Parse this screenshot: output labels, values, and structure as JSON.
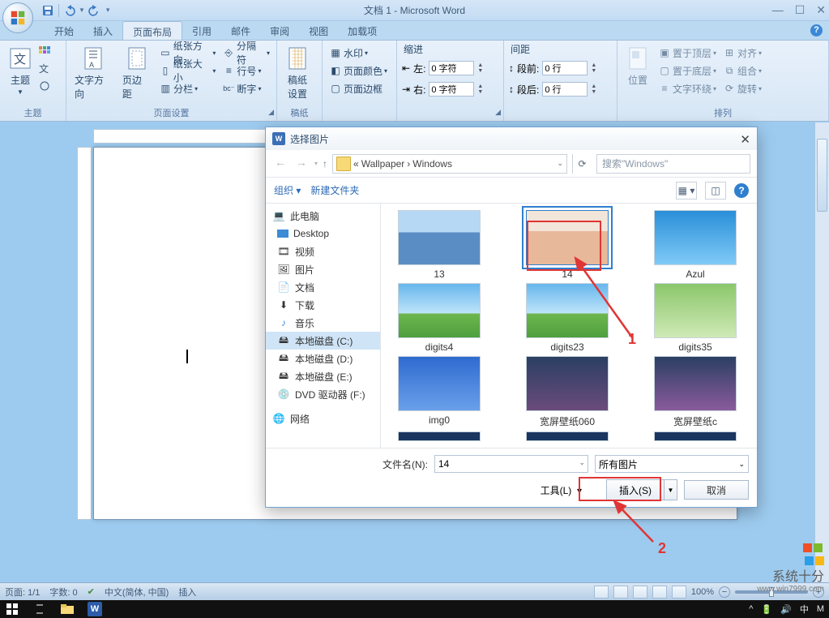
{
  "app_title": "文档 1 - Microsoft Word",
  "qat": {
    "save": "save",
    "undo": "undo",
    "redo": "redo"
  },
  "tabs": [
    {
      "label": "开始"
    },
    {
      "label": "插入"
    },
    {
      "label": "页面布局",
      "active": true
    },
    {
      "label": "引用"
    },
    {
      "label": "邮件"
    },
    {
      "label": "审阅"
    },
    {
      "label": "视图"
    },
    {
      "label": "加载项"
    }
  ],
  "ribbon": {
    "theme": {
      "label": "主题",
      "btn": "主题"
    },
    "pagesetup": {
      "label": "页面设置",
      "orientation": "文字方向",
      "margin": "页边距",
      "items": [
        {
          "label": "纸张方向"
        },
        {
          "label": "纸张大小"
        },
        {
          "label": "分栏"
        }
      ],
      "items2": [
        {
          "label": "分隔符"
        },
        {
          "label": "行号"
        },
        {
          "label": "断字"
        }
      ]
    },
    "manuscript": {
      "label": "稿纸",
      "btn": "稿纸\n设置"
    },
    "bg": {
      "label": "",
      "wm": "水印",
      "pc": "页面颜色",
      "pb": "页面边框"
    },
    "indent": {
      "label": "缩进",
      "left_lbl": "左:",
      "left_val": "0 字符",
      "right_lbl": "右:",
      "right_val": "0 字符"
    },
    "spacing": {
      "label": "间距",
      "before_lbl": "段前:",
      "before_val": "0 行",
      "after_lbl": "段后:",
      "after_val": "0 行"
    },
    "position": {
      "label": "位置",
      "btn": "位置"
    },
    "arrange": {
      "label": "排列",
      "items": [
        {
          "label": "置于顶层"
        },
        {
          "label": "置于底层"
        },
        {
          "label": "文字环绕"
        }
      ],
      "items2": [
        {
          "label": "对齐"
        },
        {
          "label": "组合"
        },
        {
          "label": "旋转"
        }
      ]
    }
  },
  "dialog": {
    "title": "选择图片",
    "breadcrumb": [
      "«",
      "Wallpaper",
      "›",
      "Windows"
    ],
    "search_placeholder": "搜索\"Windows\"",
    "toolbar": {
      "org": "组织",
      "new": "新建文件夹",
      "help": "?"
    },
    "tree": [
      {
        "label": "此电脑",
        "icon": "pc",
        "lev1": true
      },
      {
        "label": "Desktop",
        "icon": "desktop"
      },
      {
        "label": "视频",
        "icon": "video"
      },
      {
        "label": "图片",
        "icon": "pic"
      },
      {
        "label": "文档",
        "icon": "doc"
      },
      {
        "label": "下载",
        "icon": "dl"
      },
      {
        "label": "音乐",
        "icon": "music"
      },
      {
        "label": "本地磁盘 (C:)",
        "icon": "disk",
        "sel": true
      },
      {
        "label": "本地磁盘 (D:)",
        "icon": "disk"
      },
      {
        "label": "本地磁盘 (E:)",
        "icon": "disk"
      },
      {
        "label": "DVD 驱动器 (F:)",
        "icon": "dvd"
      },
      {
        "label": "网络",
        "icon": "net",
        "lev1": true
      }
    ],
    "files": [
      [
        {
          "name": "13",
          "cls": "person1"
        },
        {
          "name": "14",
          "cls": "person2",
          "sel": true
        },
        {
          "name": "Azul",
          "cls": "azul"
        }
      ],
      [
        {
          "name": "digits4",
          "cls": "sky"
        },
        {
          "name": "digits23",
          "cls": "sky"
        },
        {
          "name": "digits35",
          "cls": "flower"
        }
      ],
      [
        {
          "name": "img0",
          "cls": "win10"
        },
        {
          "name": "宽屏壁纸060",
          "cls": "city"
        },
        {
          "name": "宽屏壁纸c",
          "cls": "city2"
        }
      ]
    ],
    "filename_lbl": "文件名(N):",
    "filename_val": "14",
    "filter": "所有图片",
    "tools": "工具(L)",
    "insert": "插入(S)",
    "cancel": "取消"
  },
  "annotations": {
    "one": "1",
    "two": "2"
  },
  "status": {
    "page": "页面: 1/1",
    "words": "字数: 0",
    "lang": "中文(简体, 中国)",
    "mode": "插入",
    "zoom": "100%"
  },
  "taskbar_tray": [
    "中",
    "M"
  ],
  "watermark": {
    "text": "系统十分",
    "url": "www.win7999.com"
  }
}
